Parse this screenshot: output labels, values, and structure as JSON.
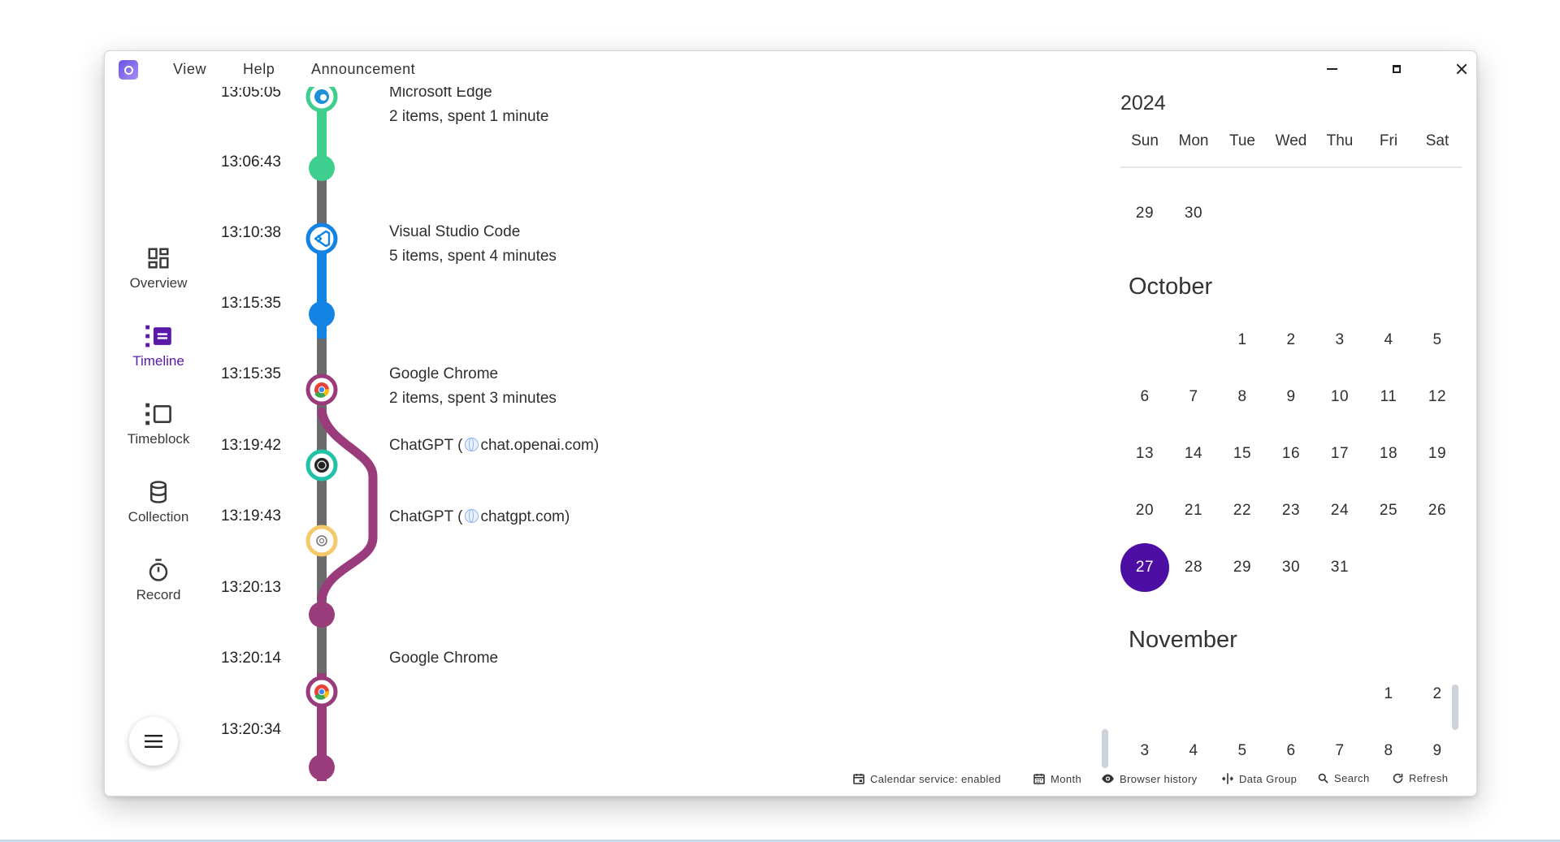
{
  "menu": {
    "view": "View",
    "help": "Help",
    "announcement": "Announcement"
  },
  "nav": {
    "items": [
      {
        "label": "Overview",
        "icon": "dashboard-icon"
      },
      {
        "label": "Timeline",
        "icon": "timeline-icon",
        "active": true
      },
      {
        "label": "Timeblock",
        "icon": "timeblock-icon"
      },
      {
        "label": "Collection",
        "icon": "database-icon"
      },
      {
        "label": "Record",
        "icon": "stopwatch-icon"
      }
    ]
  },
  "timeline": {
    "times": [
      "13:05:05",
      "13:06:43",
      "13:10:38",
      "13:15:35",
      "13:15:35",
      "13:19:42",
      "13:19:43",
      "13:20:13",
      "13:20:14",
      "13:20:34"
    ],
    "entries": {
      "edge": {
        "title": "Microsoft Edge",
        "summary": "2 items, spent 1 minute"
      },
      "vscode": {
        "title": "Visual Studio Code",
        "summary": "5 items, spent 4 minutes"
      },
      "chrome1": {
        "title": "Google Chrome",
        "summary": "2 items, spent 3 minutes"
      },
      "chatgpt1": {
        "name": "ChatGPT (",
        "domain": "chat.openai.com",
        "close": ")"
      },
      "chatgpt2": {
        "name": "ChatGPT (",
        "domain": "chatgpt.com",
        "close": ")"
      },
      "chrome2": {
        "title": "Google Chrome"
      }
    },
    "colors": {
      "edge": "#3ecf8e",
      "vscode": "#1384e3",
      "chrome": "#9a3b7c",
      "trunk": "#6b6b6b",
      "chatgpt1": "#22c2a8",
      "chatgpt2": "#f5c86a"
    }
  },
  "calendar": {
    "year": "2024",
    "weekdays": [
      "Sun",
      "Mon",
      "Tue",
      "Wed",
      "Thu",
      "Fri",
      "Sat"
    ],
    "prev_tail": [
      "29",
      "30"
    ],
    "months": [
      {
        "name": "October",
        "first_weekday": 2,
        "days": 31,
        "selected": 27
      },
      {
        "name": "November",
        "first_weekday": 5,
        "visible_days": 9
      }
    ],
    "selected_color": "#4d0fa3"
  },
  "statusbar": {
    "calendar_service": "Calendar service: enabled",
    "month": "Month",
    "browser_history": "Browser history",
    "data_group": "Data Group",
    "search": "Search",
    "refresh": "Refresh"
  }
}
